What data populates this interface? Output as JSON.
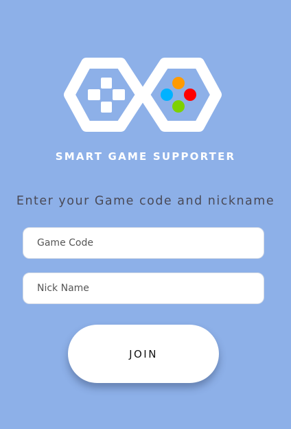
{
  "header": {
    "logo_icon": "game-controller-logo-icon",
    "app_title": "SMART GAME SUPPORTER"
  },
  "prompt": "Enter your Game code and nickname",
  "form": {
    "game_code": {
      "value": "",
      "placeholder": "Game Code"
    },
    "nickname": {
      "value": "",
      "placeholder": "Nick Name"
    },
    "join_label": "JOIN"
  },
  "colors": {
    "background": "#8db0e8",
    "button_colors": [
      "#ff9a00",
      "#00b2ff",
      "#ff0000",
      "#7ed100"
    ]
  }
}
